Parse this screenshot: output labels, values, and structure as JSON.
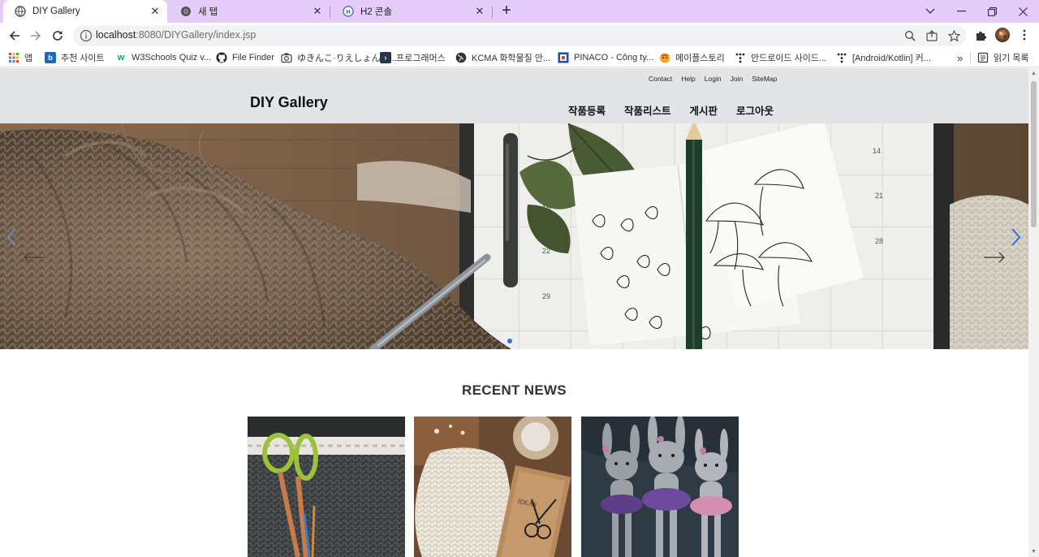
{
  "browser": {
    "tabs": [
      {
        "title": "DIY Gallery",
        "active": true
      },
      {
        "title": "새 탭",
        "active": false
      },
      {
        "title": "H2 콘솔",
        "active": false
      }
    ],
    "url_host": "localhost",
    "url_path": ":8080/DIYGallery/index.jsp",
    "bookmarks": [
      {
        "label": "앱",
        "icon": "apps-grid-icon"
      },
      {
        "label": "추천 사이트",
        "icon": "bing-icon"
      },
      {
        "label": "W3Schools Quiz v...",
        "icon": "w3schools-icon"
      },
      {
        "label": "File Finder",
        "icon": "github-icon"
      },
      {
        "label": "ゆきんこ·りえしょんの...",
        "icon": "camera-icon"
      },
      {
        "label": "프로그래머스",
        "icon": "programmers-icon"
      },
      {
        "label": "KCMA 화학물질 안...",
        "icon": "globe-icon"
      },
      {
        "label": "PINACO - Công ty...",
        "icon": "pinaco-icon"
      },
      {
        "label": "메이플스토리",
        "icon": "maplestory-icon"
      },
      {
        "label": "안드로이드 사이드...",
        "icon": "dots-icon"
      },
      {
        "label": "[Android/Kotlin] 커...",
        "icon": "dots-icon"
      }
    ],
    "bookmarks_overflow": "»",
    "reading_list": "읽기 목록",
    "accent": "#e5ccfb"
  },
  "site": {
    "top_links": [
      "Contact",
      "Help",
      "Login",
      "Join",
      "SiteMap"
    ],
    "logo": "DIY Gallery",
    "nav": [
      "작품등록",
      "작품리스트",
      "게시판",
      "로그아웃"
    ],
    "header_bg": "#e2e4e6",
    "section_title": "RECENT NEWS",
    "carousel_slides": 1
  }
}
